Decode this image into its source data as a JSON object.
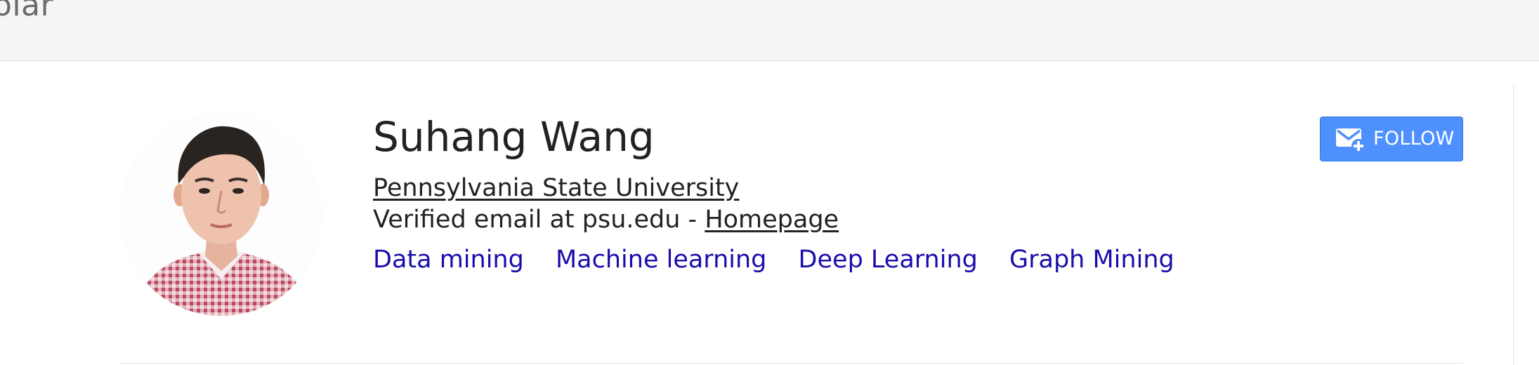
{
  "header": {
    "brand_text": "olar"
  },
  "profile": {
    "name": "Suhang Wang",
    "affiliation": "Pennsylvania State University",
    "email_text": "Verified email at psu.edu - ",
    "homepage_label": "Homepage",
    "interests": [
      "Data mining",
      "Machine learning",
      "Deep Learning",
      "Graph Mining"
    ],
    "follow_label": "FOLLOW"
  },
  "colors": {
    "follow_button": "#4d90fe",
    "interest_link": "#1a0dab"
  },
  "icons": {
    "follow": "envelope-plus-icon"
  }
}
